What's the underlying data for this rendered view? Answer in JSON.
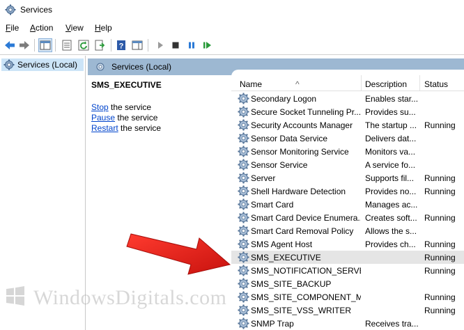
{
  "window": {
    "title": "Services"
  },
  "menu": [
    {
      "key": "F",
      "rest": "ile"
    },
    {
      "key": "A",
      "rest": "ction"
    },
    {
      "key": "V",
      "rest": "iew"
    },
    {
      "key": "H",
      "rest": "elp"
    }
  ],
  "tree": {
    "root": "Services (Local)"
  },
  "panel": {
    "header": "Services (Local)"
  },
  "detail": {
    "service_name": "SMS_EXECUTIVE",
    "actions": [
      {
        "link": "Stop",
        "suffix": " the service"
      },
      {
        "link": "Pause",
        "suffix": " the service"
      },
      {
        "link": "Restart",
        "suffix": " the service"
      }
    ]
  },
  "table": {
    "columns": {
      "name": "Name",
      "description": "Description",
      "status": "Status"
    },
    "sort_indicator": "^",
    "rows": [
      {
        "name": "Secondary Logon",
        "description": "Enables star...",
        "status": ""
      },
      {
        "name": "Secure Socket Tunneling Pr...",
        "description": "Provides su...",
        "status": ""
      },
      {
        "name": "Security Accounts Manager",
        "description": "The startup ...",
        "status": "Running"
      },
      {
        "name": "Sensor Data Service",
        "description": "Delivers dat...",
        "status": ""
      },
      {
        "name": "Sensor Monitoring Service",
        "description": "Monitors va...",
        "status": ""
      },
      {
        "name": "Sensor Service",
        "description": "A service fo...",
        "status": ""
      },
      {
        "name": "Server",
        "description": "Supports fil...",
        "status": "Running"
      },
      {
        "name": "Shell Hardware Detection",
        "description": "Provides no...",
        "status": "Running"
      },
      {
        "name": "Smart Card",
        "description": "Manages ac...",
        "status": ""
      },
      {
        "name": "Smart Card Device Enumera...",
        "description": "Creates soft...",
        "status": "Running"
      },
      {
        "name": "Smart Card Removal Policy",
        "description": "Allows the s...",
        "status": ""
      },
      {
        "name": "SMS Agent Host",
        "description": "Provides ch...",
        "status": "Running"
      },
      {
        "name": "SMS_EXECUTIVE",
        "description": "",
        "status": "Running",
        "selected": true
      },
      {
        "name": "SMS_NOTIFICATION_SERVER",
        "description": "",
        "status": "Running"
      },
      {
        "name": "SMS_SITE_BACKUP",
        "description": "",
        "status": ""
      },
      {
        "name": "SMS_SITE_COMPONENT_M...",
        "description": "",
        "status": "Running"
      },
      {
        "name": "SMS_SITE_VSS_WRITER",
        "description": "",
        "status": "Running"
      },
      {
        "name": "SNMP Trap",
        "description": "Receives tra...",
        "status": ""
      }
    ]
  },
  "watermark": {
    "text": "WindowsDigitals.com"
  },
  "colors": {
    "panel_header": "#9db8d2",
    "selected_row": "#e5e5e5",
    "arrow": "#e8201e",
    "link": "#0044cc"
  },
  "icons": [
    "services-gear-icon",
    "back-icon",
    "forward-icon",
    "console-tree-icon",
    "properties-icon",
    "refresh-icon",
    "export-icon",
    "help-icon",
    "show-hide-pane-icon",
    "start-icon",
    "stop-icon",
    "pause-icon",
    "resume-icon"
  ]
}
